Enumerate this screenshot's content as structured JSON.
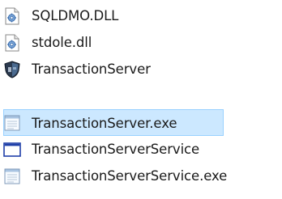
{
  "files": [
    {
      "name": "SQLDMO.DLL",
      "icon": "dll-file-icon"
    },
    {
      "name": "stdole.dll",
      "icon": "dll-file-icon"
    },
    {
      "name": "TransactionServer",
      "icon": "application-shield-icon"
    },
    {
      "name": "TransactionServer.exe",
      "icon": "exe-file-icon",
      "selected": true
    },
    {
      "name": "TransactionServerService",
      "icon": "application-window-icon"
    },
    {
      "name": "TransactionServerService.exe",
      "icon": "exe-file-icon"
    }
  ],
  "colors": {
    "selection_background": "#cce8ff",
    "selection_border": "#99d1ff",
    "text": "#1a1a1a"
  }
}
